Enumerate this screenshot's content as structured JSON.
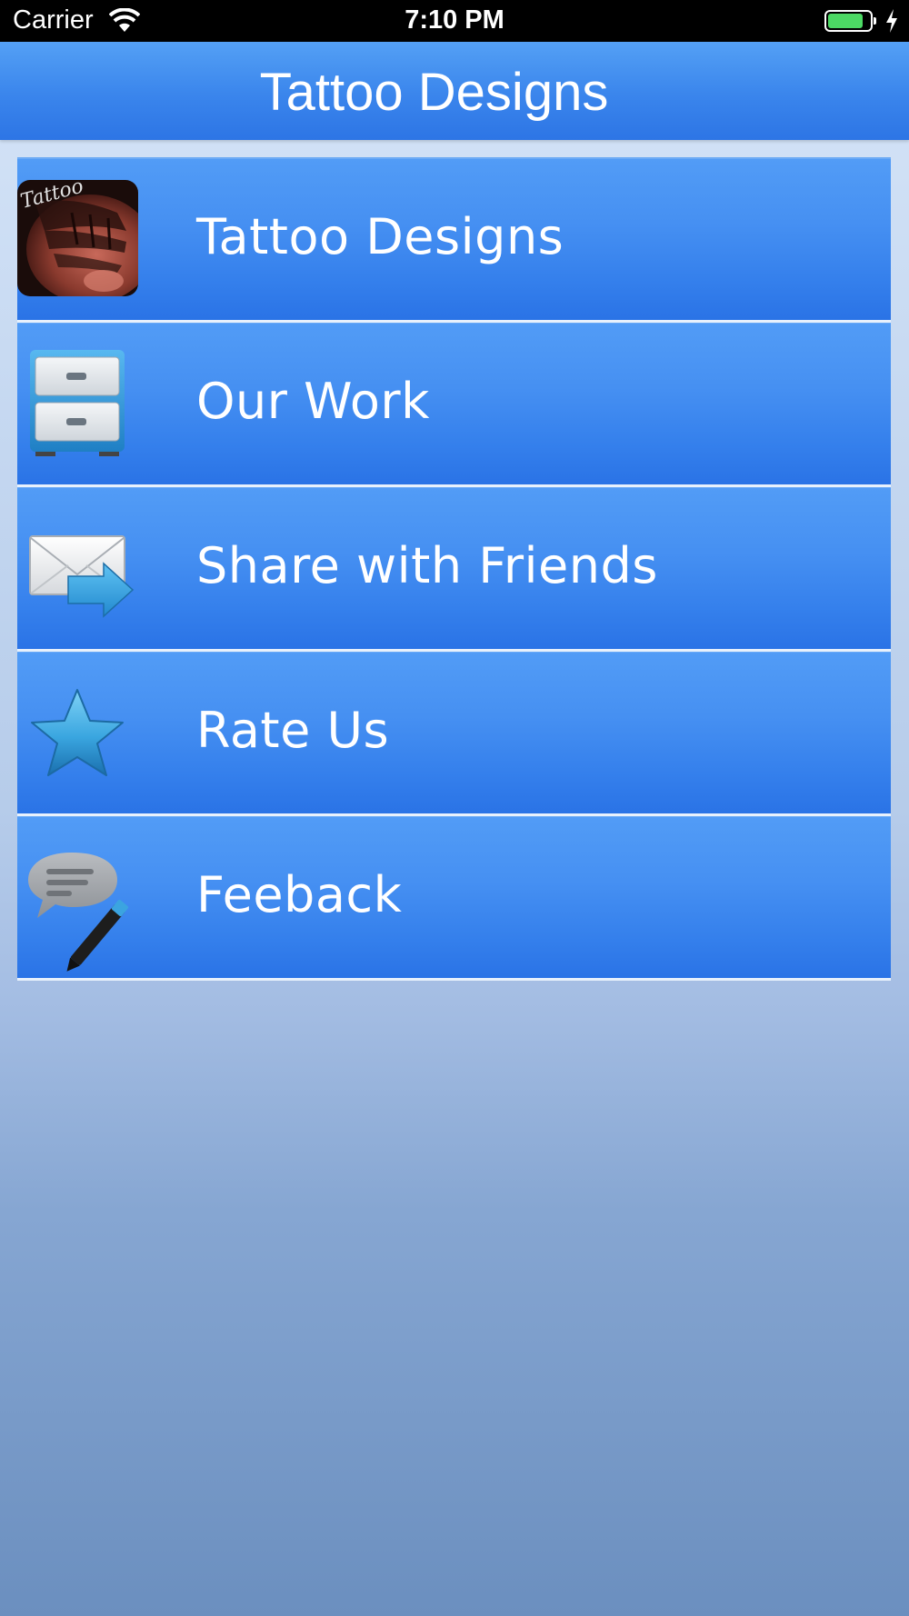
{
  "status_bar": {
    "carrier": "Carrier",
    "time": "7:10 PM"
  },
  "nav": {
    "title": "Tattoo Designs"
  },
  "menu": {
    "items": [
      {
        "label": "Tattoo Designs",
        "icon": "tattoo-photo-icon",
        "thumb_text": "Tattoo"
      },
      {
        "label": "Our Work",
        "icon": "file-cabinet-icon"
      },
      {
        "label": "Share with Friends",
        "icon": "mail-forward-icon"
      },
      {
        "label": "Rate Us",
        "icon": "star-icon"
      },
      {
        "label": "Feeback",
        "icon": "speech-bubble-pencil-icon"
      }
    ]
  },
  "colors": {
    "nav_bar": "#3a85ec",
    "menu_item": "#4690f2",
    "battery": "#4cd964"
  }
}
